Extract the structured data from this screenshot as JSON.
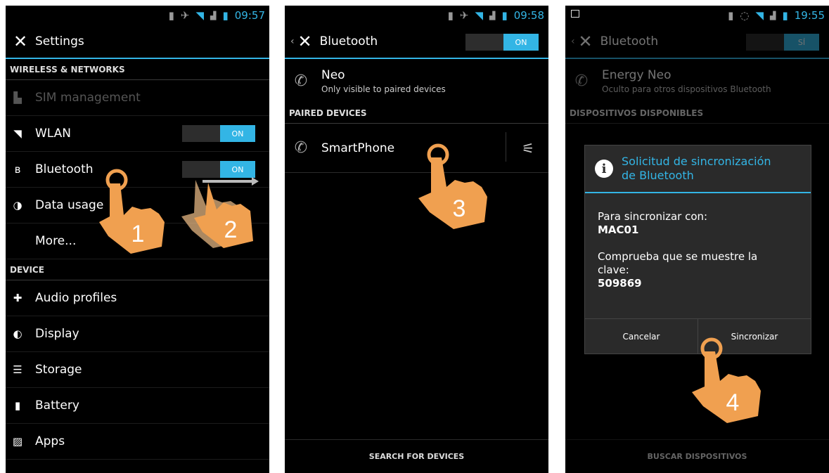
{
  "screen1": {
    "time": "09:57",
    "title": "Settings",
    "sections": {
      "wireless": "WIRELESS & NETWORKS",
      "device": "DEVICE"
    },
    "items": [
      {
        "label": "SIM management",
        "icon": "sim-icon"
      },
      {
        "label": "WLAN",
        "icon": "wifi-icon",
        "toggle": "ON"
      },
      {
        "label": "Bluetooth",
        "icon": "bluetooth-icon",
        "toggle": "ON"
      },
      {
        "label": "Data usage",
        "icon": "data-usage-icon"
      },
      {
        "label": "More...",
        "icon": ""
      }
    ],
    "device_items": [
      {
        "label": "Audio profiles",
        "icon": "audio-profiles-icon"
      },
      {
        "label": "Display",
        "icon": "display-icon"
      },
      {
        "label": "Storage",
        "icon": "storage-icon"
      },
      {
        "label": "Battery",
        "icon": "battery-icon"
      },
      {
        "label": "Apps",
        "icon": "apps-icon"
      }
    ],
    "steps": [
      "1",
      "2"
    ]
  },
  "screen2": {
    "time": "09:58",
    "title": "Bluetooth",
    "toggle": "ON",
    "device_name": "Neo",
    "visibility": "Only visible to paired devices",
    "paired_header": "PAIRED DEVICES",
    "paired_device": "SmartPhone",
    "search": "SEARCH FOR DEVICES",
    "step": "3"
  },
  "screen3": {
    "time": "19:55",
    "title": "Bluetooth",
    "toggle": "SÍ",
    "device_name": "Energy Neo",
    "visibility": "Oculto para otros dispositivos Bluetooth",
    "available_header": "DISPOSITIVOS DISPONIBLES",
    "search": "BUSCAR DISPOSITIVOS",
    "dialog": {
      "title_line1": "Solicitud de sincronización",
      "title_line2": "de Bluetooth",
      "sync_with": "Para sincronizar con:",
      "device": "MAC01",
      "check_line1": "Comprueba que se muestre la",
      "check_line2": "clave:",
      "key": "509869",
      "cancel": "Cancelar",
      "confirm": "Sincronizar"
    },
    "step": "4"
  },
  "colors": {
    "accent": "#33b5e5",
    "hand": "#f0a050"
  }
}
